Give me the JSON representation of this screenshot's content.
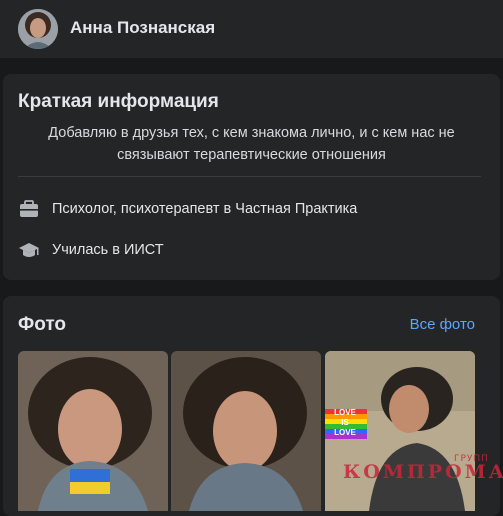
{
  "profile": {
    "name": "Анна Познанская"
  },
  "intro": {
    "title": "Краткая информация",
    "bio": "Добавляю в друзья тех, с кем знакома лично, и с кем нас не связывают терапевтические отношения",
    "items": [
      {
        "icon": "briefcase-icon",
        "text": "Психолог, психотерапевт в Частная Практика"
      },
      {
        "icon": "graduation-cap-icon",
        "text": "Училась в ИИСТ"
      }
    ]
  },
  "photos": {
    "title": "Фото",
    "see_all_label": "Все фото",
    "poster_text": [
      "LOVE",
      "IS",
      "LOVE"
    ]
  },
  "watermark": {
    "text": "КОМПРОМАТ",
    "sup": "ГРУПП"
  },
  "colors": {
    "background": "#18191a",
    "card": "#242526",
    "link": "#5aa7ff",
    "watermark": "#c8273a"
  }
}
